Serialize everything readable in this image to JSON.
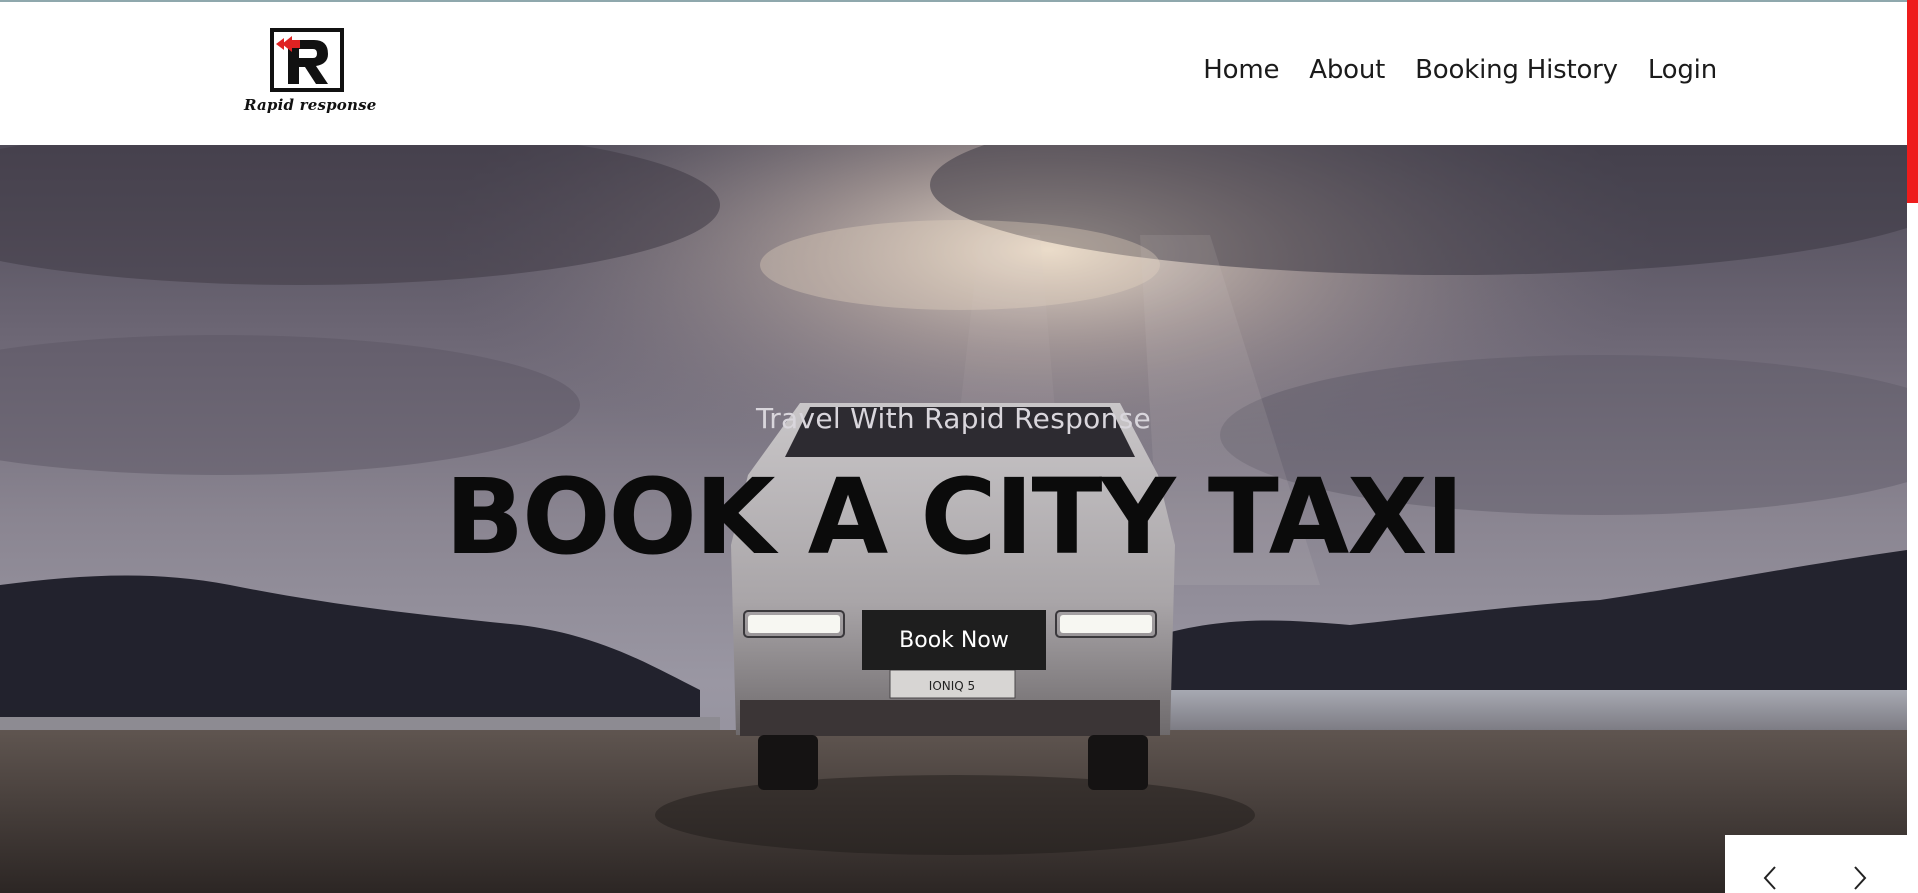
{
  "brand": {
    "logo_text": "Rapid response",
    "logo_icon": "rapid-response-r-logo",
    "accent_color": "#ee1c1c"
  },
  "nav": {
    "items": [
      {
        "label": "Home"
      },
      {
        "label": "About"
      },
      {
        "label": "Booking History"
      },
      {
        "label": "Login"
      }
    ]
  },
  "hero": {
    "tagline": "Travel With Rapid Response",
    "headline": "BOOK A CITY TAXI",
    "cta_label": "Book Now",
    "plate_text": "IONIQ 5"
  },
  "slider": {
    "prev_icon": "chevron-left-icon",
    "next_icon": "chevron-right-icon"
  }
}
